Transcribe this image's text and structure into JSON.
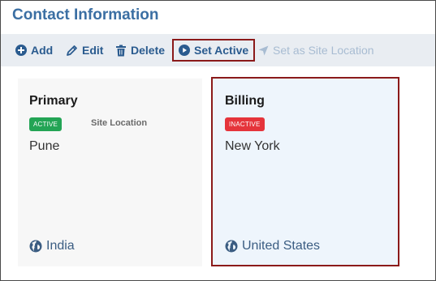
{
  "title": "Contact Information",
  "toolbar": {
    "add": "Add",
    "edit": "Edit",
    "delete": "Delete",
    "set_active": "Set Active",
    "set_site_location": "Set as Site Location"
  },
  "cards": [
    {
      "name": "Primary",
      "status": "ACTIVE",
      "status_color": "#23a455",
      "site_location": "Site Location",
      "city": "Pune",
      "country": "India",
      "selected": false
    },
    {
      "name": "Billing",
      "status": "INACTIVE",
      "status_color": "#e5343b",
      "city": "New York",
      "country": "United States",
      "selected": true
    }
  ],
  "colors": {
    "accent": "#2a5b8f",
    "selection_border": "#8b1a1a",
    "title": "#3b6fa3"
  }
}
